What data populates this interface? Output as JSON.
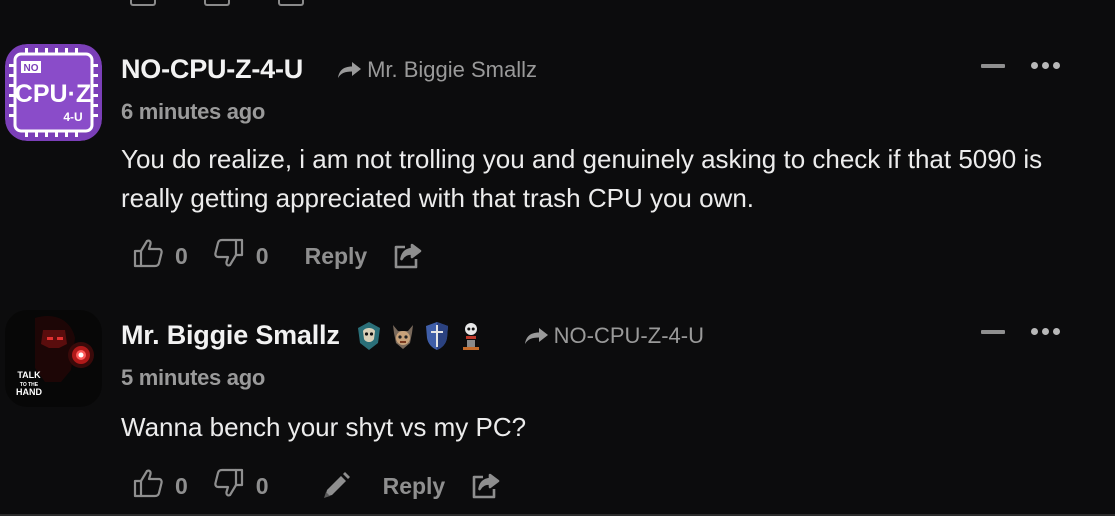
{
  "comments": [
    {
      "username": "NO-CPU-Z-4-U",
      "reply_to": "Mr. Biggie Smallz",
      "timestamp": "6 minutes ago",
      "body": "You do realize, i am not trolling you and genuinely asking to check if that 5090 is really getting appreciated with that trash CPU you own.",
      "likes": "0",
      "dislikes": "0",
      "reply_label": "Reply",
      "avatar_text": {
        "top": "NO",
        "main": "CPU·Z",
        "bottom": "4-U"
      }
    },
    {
      "username": "Mr. Biggie Smallz",
      "reply_to": "NO-CPU-Z-4-U",
      "timestamp": "5 minutes ago",
      "body": "Wanna bench your shyt vs my PC?",
      "likes": "0",
      "dislikes": "0",
      "reply_label": "Reply",
      "avatar_text": {
        "line1": "TALK",
        "line2": "TO THE",
        "line3": "HAND"
      },
      "badges": [
        "teal-mask-badge",
        "horned-skull-badge",
        "shield-badge",
        "skeleton-badge"
      ]
    }
  ],
  "colors": {
    "background": "#0c0c0d",
    "text": "#ececec",
    "muted": "#9a9a9a",
    "avatar_purple": "#7b3fb8"
  }
}
